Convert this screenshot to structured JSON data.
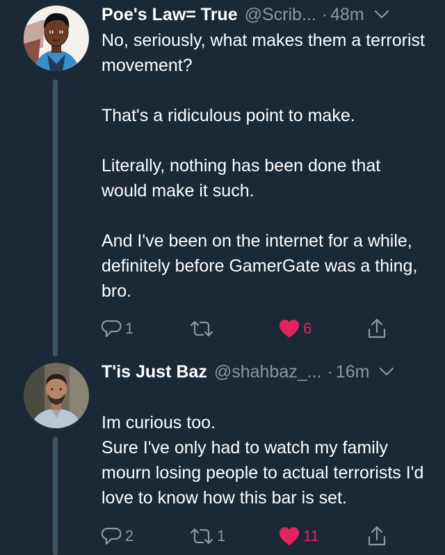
{
  "tweets": [
    {
      "name": "Poe's Law= True",
      "handle": "@Scrib...",
      "separator": "·",
      "time": "48m",
      "paragraphs": [
        "No, seriously, what makes them a terrorist movement?",
        "That's a ridiculous point to make.",
        "Literally, nothing has been done that would make it such.",
        "And I've been on the internet for a while, definitely before GamerGate was a thing, bro."
      ],
      "replies": "1",
      "retweets": "",
      "likes": "6",
      "liked": true
    },
    {
      "name": "T'is Just Baz",
      "handle": "@shahbaz_...",
      "separator": "·",
      "time": "16m",
      "paragraphs": [
        "Im curious too.\nSure I've only had to watch my family mourn losing people to actual terrorists I'd love to know how this bar is set."
      ],
      "replies": "2",
      "retweets": "1",
      "likes": "11",
      "liked": true
    }
  ],
  "icons": {
    "reply": "reply-icon",
    "retweet": "retweet-icon",
    "like": "heart-icon",
    "share": "share-icon",
    "menu": "chevron-down-icon"
  },
  "colors": {
    "background": "#1b2836",
    "text": "#ffffff",
    "muted": "#8899a6",
    "like": "#e0245e",
    "thread_line": "#3d5466"
  }
}
